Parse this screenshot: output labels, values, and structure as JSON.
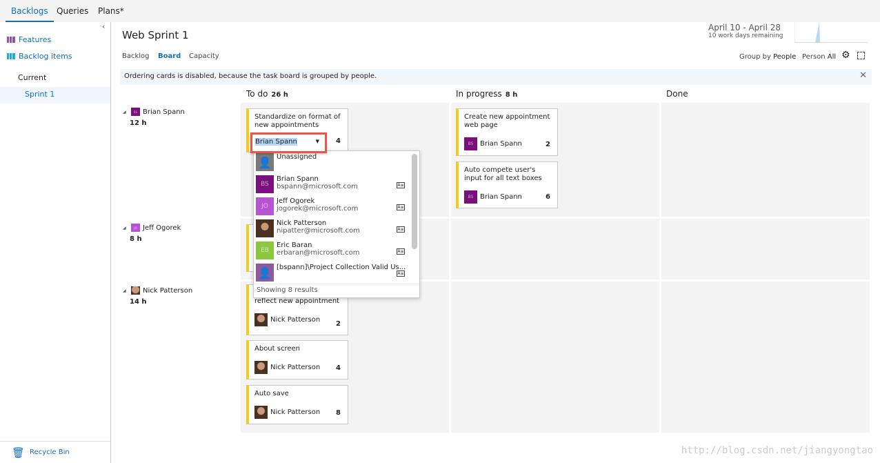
{
  "topnav": {
    "tabs": [
      "Backlogs",
      "Queries",
      "Plans*"
    ]
  },
  "sidebar": {
    "items": [
      {
        "label": "Features",
        "color": "#773b93"
      },
      {
        "label": "Backlog items",
        "color": "#009ccc"
      }
    ],
    "section": "Current",
    "sprint": "Sprint 1",
    "recycle": "Recycle Bin"
  },
  "header": {
    "title": "Web Sprint 1",
    "tabs": [
      "Backlog",
      "Board",
      "Capacity"
    ],
    "active_tab": "Board",
    "dates": "April 10 - April 28",
    "remaining": "10 work days remaining",
    "group_by_label": "Group by",
    "group_by_value": "People",
    "person_label": "Person",
    "person_value": "All"
  },
  "info": "Ordering cards is disabled, because the task board is grouped by people.",
  "columns": [
    {
      "name": "To do",
      "hours": "26 h"
    },
    {
      "name": "In progress",
      "hours": "8 h"
    },
    {
      "name": "Done",
      "hours": ""
    }
  ],
  "rows": [
    {
      "name": "Brian Spann",
      "hours": "12 h",
      "color": "#7a0f7d",
      "initials": "BS"
    },
    {
      "name": "Jeff Ogorek",
      "hours": "8 h",
      "color": "#b854d4",
      "initials": "JO"
    },
    {
      "name": "Nick Patterson",
      "hours": "14 h",
      "photo": true
    }
  ],
  "cards": [
    {
      "title": "Standardize on format of new appointments",
      "remaining": "4",
      "editing": true
    },
    {
      "title": "Create new appointment web page",
      "assignee": "Brian Spann",
      "initials": "BS",
      "color": "#7a0f7d",
      "remaining": "2"
    },
    {
      "title": "Auto compete user's input for all text boxes",
      "assignee": "Brian Spann",
      "initials": "BS",
      "color": "#7a0f7d",
      "remaining": "6"
    },
    {
      "title": "reflect new appointment",
      "assignee": "Nick Patterson",
      "photo": true,
      "remaining": "2"
    },
    {
      "title": "About screen",
      "assignee": "Nick Patterson",
      "photo": true,
      "remaining": "4"
    },
    {
      "title": "Auto save",
      "assignee": "Nick Patterson",
      "photo": true,
      "remaining": "8"
    }
  ],
  "picker": {
    "value": "Brian Spann",
    "options": [
      {
        "name": "Unassigned",
        "color": "#7a7a7a"
      },
      {
        "name": "Brian Spann",
        "email": "bspann@microsoft.com",
        "initials": "BS",
        "color": "#7a0f7d"
      },
      {
        "name": "Jeff Ogorek",
        "email": "jogorek@microsoft.com",
        "initials": "JO",
        "color": "#b854d4"
      },
      {
        "name": "Nick Patterson",
        "email": "nipatter@microsoft.com",
        "photo": true
      },
      {
        "name": "Eric Baran",
        "email": "erbaran@microsoft.com",
        "initials": "EB",
        "color": "#8dc63f"
      },
      {
        "name": "[bspann]\\Project Collection Valid Us...",
        "color": "#8e5a9d"
      }
    ],
    "footer": "Showing 8 results"
  },
  "watermark": "http://blog.csdn.net/jiangyongtao",
  "colors": {
    "accent": "#106ebe",
    "card_bar": "#f2cb1d",
    "highlight": "#e8584a"
  }
}
